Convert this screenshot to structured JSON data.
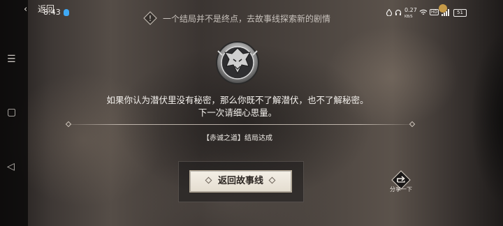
{
  "status_bar": {
    "time": "8:43",
    "network_speed": "0.27",
    "network_unit": "KB/S",
    "battery": "51",
    "right_icons": [
      "alarm-icon",
      "headset-icon",
      "wifi-icon",
      "hd-icon",
      "signal-icon",
      "battery-icon"
    ]
  },
  "header": {
    "back_label": "返回",
    "hint": "一个结局并不是终点，去故事线探索新的剧情"
  },
  "ending": {
    "quote_line1": "如果你认为潜伏里没有秘密，那么你既不了解潜伏，也不了解秘密。",
    "quote_line2": "下一次请细心思量。",
    "label": "【赤诚之道】结局达成"
  },
  "actions": {
    "return_label": "返回故事线",
    "share_label": "分享一下"
  },
  "colors": {
    "text_light": "#f4f1ed",
    "button_bg": "#f0ebe2",
    "qq_blue": "#3fa9f5"
  }
}
